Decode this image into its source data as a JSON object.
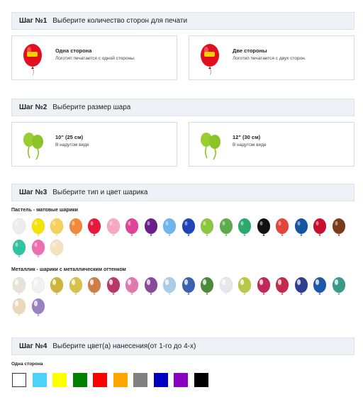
{
  "step1": {
    "num": "Шаг №1",
    "title": "Выберите количество сторон для печати",
    "options": [
      {
        "title": "Одна сторона",
        "sub": "Логотип печатается с одной стороны."
      },
      {
        "title": "Две стороны",
        "sub": "Логотип печатается с двух сторон."
      }
    ]
  },
  "step2": {
    "num": "Шаг №2",
    "title": "Выберите размер шара",
    "options": [
      {
        "title": "10\" (25 см)",
        "sub": "В надутом виде"
      },
      {
        "title": "12\" (30 см)",
        "sub": "В надутом виде"
      }
    ]
  },
  "step3": {
    "num": "Шаг №3",
    "title": "Выберите тип и цвет шарика",
    "pastel_label": "Пастель - матовые шарики",
    "metallic_label": "Металлик - шарики с металлическим оттенком",
    "pastel_colors": [
      "#ededed",
      "#f6e200",
      "#f7d25a",
      "#f08a3a",
      "#e8183c",
      "#f7a9bf",
      "#e0449a",
      "#6b1f8a",
      "#6cb6ec",
      "#1e44b8",
      "#8cc63f",
      "#5dab4a",
      "#2da96e",
      "#111111",
      "#e0463a",
      "#1755a0",
      "#c8102e",
      "#7a3b1c",
      "#32c4a0",
      "#ee6fb0",
      "#f5e2c0"
    ],
    "metallic_colors": [
      "#e8e2d8",
      "#f1f1f1",
      "#cdb43a",
      "#d4c24a",
      "#cc8048",
      "#b8386a",
      "#e07aac",
      "#8a4a9a",
      "#a9cde8",
      "#3a62b0",
      "#4a8a38",
      "#e6e6ee",
      "#b8c844",
      "#c0285a",
      "#c42a4c",
      "#2e3e8e",
      "#1e58a8",
      "#3a9a8a",
      "#ead8b8",
      "#9882c0"
    ]
  },
  "step4": {
    "num": "Шаг №4",
    "title": "Выберите цвет(а) нанесения(от 1-го до 4-х)",
    "side_label": "Одна сторона",
    "colors": [
      "#ffffff",
      "#4dd2f7",
      "#ffff00",
      "#008000",
      "#ff0000",
      "#ffa500",
      "#808080",
      "#0000c0",
      "#8a00c0",
      "#000000"
    ]
  },
  "colors": {
    "header_bg": "#eef1f6",
    "logo_balloon": "#e01020",
    "size_balloon": "#9acd32"
  }
}
